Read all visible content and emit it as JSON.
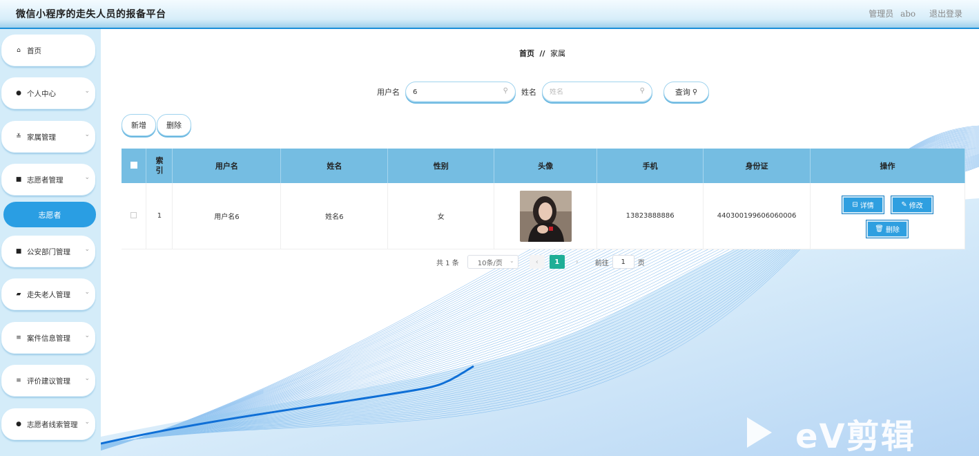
{
  "header": {
    "title": "微信小程序的走失人员的报备平台",
    "role": "管理员",
    "username": "abo",
    "logout": "退出登录"
  },
  "sidebar": {
    "items": [
      {
        "label": "首页",
        "icon": "home-icon",
        "glyph": "⌂"
      },
      {
        "label": "个人中心",
        "icon": "user-icon",
        "glyph": "●"
      },
      {
        "label": "家属管理",
        "icon": "sliders-icon",
        "glyph": "≚"
      },
      {
        "label": "志愿者管理",
        "icon": "grid-icon",
        "glyph": "■"
      },
      {
        "label": "公安部门管理",
        "icon": "grid-icon",
        "glyph": "■"
      },
      {
        "label": "走失老人管理",
        "icon": "wallet-icon",
        "glyph": "▰"
      },
      {
        "label": "案件信息管理",
        "icon": "list-icon",
        "glyph": "≡"
      },
      {
        "label": "评价建议管理",
        "icon": "list-icon",
        "glyph": "≡"
      },
      {
        "label": "志愿者线索管理",
        "icon": "bulb-icon",
        "glyph": "●"
      }
    ],
    "active": "志愿者",
    "chevron": "⌄"
  },
  "breadcrumb": {
    "home": "首页",
    "sep": "//",
    "current": "家属"
  },
  "search": {
    "username_label": "用户名",
    "username_value": "6",
    "name_label": "姓名",
    "name_placeholder": "姓名",
    "query": "查询"
  },
  "actions": {
    "add": "新增",
    "delete": "删除"
  },
  "table": {
    "headers": [
      "索引",
      "用户名",
      "姓名",
      "性别",
      "头像",
      "手机",
      "身份证",
      "操作"
    ],
    "rows": [
      {
        "index": "1",
        "username": "用户名6",
        "name": "姓名6",
        "gender": "女",
        "phone": "13823888886",
        "id_card": "440300199606060006"
      }
    ],
    "op_detail": "详情",
    "op_edit": "修改",
    "op_delete": "删除"
  },
  "pager": {
    "total": "共 1 条",
    "page_size": "10条/页",
    "current_page": "1",
    "goto": "前往",
    "goto_value": "1",
    "page_unit": "页"
  },
  "watermark": "eV剪辑",
  "colors": {
    "accent": "#2a9ee3",
    "header_row": "#75bde2",
    "page_active": "#1eae96"
  }
}
